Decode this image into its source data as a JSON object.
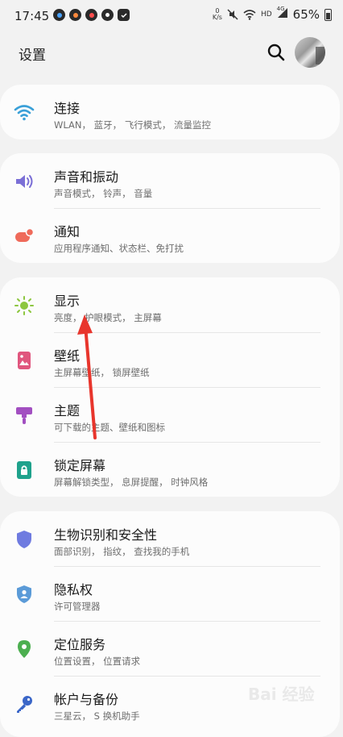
{
  "status_bar": {
    "time": "17:45",
    "net_speed_top": "0",
    "net_speed_unit": "K/s",
    "hd_label": "HD",
    "signal_label": "4G",
    "battery": "65%"
  },
  "header": {
    "title": "设置"
  },
  "sections": [
    {
      "items": [
        {
          "title": "连接",
          "subtitle": "WLAN， 蓝牙， 飞行模式， 流量监控",
          "icon": "wifi-icon",
          "color": "#3aa0d8"
        }
      ]
    },
    {
      "items": [
        {
          "title": "声音和振动",
          "subtitle": "声音模式， 铃声， 音量",
          "icon": "speaker-icon",
          "color": "#7b6fd6"
        },
        {
          "title": "通知",
          "subtitle": "应用程序通知、状态栏、免打扰",
          "icon": "notification-icon",
          "color": "#ef6a5a"
        }
      ]
    },
    {
      "items": [
        {
          "title": "显示",
          "subtitle": "亮度， 护眼模式， 主屏幕",
          "icon": "sun-icon",
          "color": "#8cc63f"
        },
        {
          "title": "壁纸",
          "subtitle": "主屏幕壁纸， 锁屏壁纸",
          "icon": "picture-icon",
          "color": "#e0567e"
        },
        {
          "title": "主题",
          "subtitle": "可下载的主题、壁纸和图标",
          "icon": "brush-icon",
          "color": "#a24fc1"
        },
        {
          "title": "锁定屏幕",
          "subtitle": "屏幕解锁类型， 息屏提醒， 时钟风格",
          "icon": "lock-icon",
          "color": "#1fa28c"
        }
      ]
    },
    {
      "items": [
        {
          "title": "生物识别和安全性",
          "subtitle": "面部识别， 指纹， 查找我的手机",
          "icon": "shield-icon",
          "color": "#6f7be0"
        },
        {
          "title": "隐私权",
          "subtitle": "许可管理器",
          "icon": "privacy-shield-icon",
          "color": "#5b9bd8"
        },
        {
          "title": "定位服务",
          "subtitle": "位置设置， 位置请求",
          "icon": "location-pin-icon",
          "color": "#4caf50"
        },
        {
          "title": "帐户与备份",
          "subtitle": "三星云， S 换机助手",
          "icon": "key-icon",
          "color": "#3a66c8"
        }
      ]
    }
  ],
  "watermark": "Bai 经验"
}
